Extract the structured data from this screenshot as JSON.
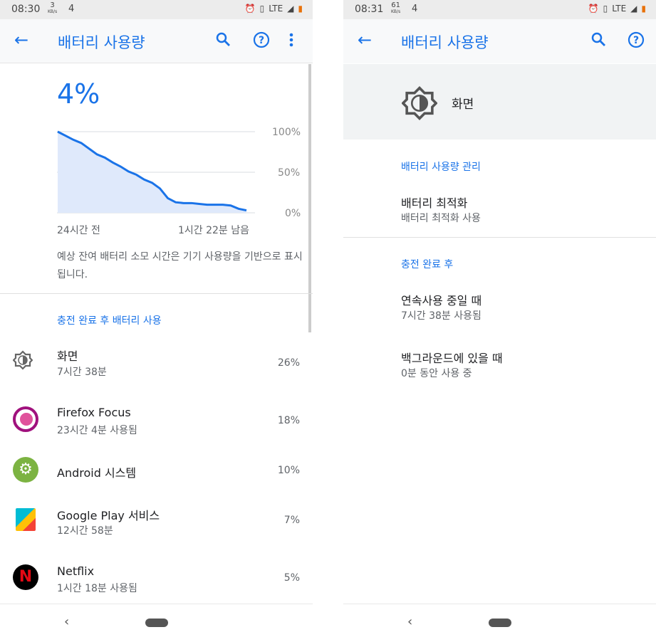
{
  "left": {
    "status": {
      "time": "08:30",
      "speed": "3",
      "speed_unit": "KB/s",
      "notif": "4",
      "network": "LTE"
    },
    "title": "배터리 사용량",
    "battery_percent": "4%",
    "chart_data": {
      "type": "area",
      "title": "",
      "y_ticks": [
        "100%",
        "50%",
        "0%"
      ],
      "x_labels": [
        "24시간 전",
        "1시간 22분 남음"
      ],
      "ylim": [
        0,
        100
      ],
      "x": [
        0,
        1,
        2,
        3,
        4,
        5,
        6,
        7,
        8,
        9,
        10,
        11,
        12,
        13,
        14,
        15,
        16,
        17,
        18,
        19,
        20,
        21,
        22,
        23,
        24
      ],
      "values": [
        100,
        95,
        90,
        86,
        79,
        72,
        68,
        62,
        57,
        51,
        47,
        41,
        37,
        30,
        18,
        13,
        12,
        12,
        11,
        10,
        10,
        10,
        9,
        5,
        3
      ]
    },
    "note": "예상 잔여 배터리 소모 시간은 기기 사용량을 기반으로 표시됩니다.",
    "section": "충전 완료 후 배터리 사용",
    "apps": [
      {
        "name": "화면",
        "sub": "7시간 38분",
        "pct": "26%",
        "icon": "brightness-icon"
      },
      {
        "name": "Firefox Focus",
        "sub": "23시간 4분 사용됨",
        "pct": "18%",
        "icon": "firefox-focus-icon"
      },
      {
        "name": "Android 시스템",
        "sub": "",
        "pct": "10%",
        "icon": "android-system-icon"
      },
      {
        "name": "Google Play 서비스",
        "sub": "12시간 58분",
        "pct": "7%",
        "icon": "google-play-services-icon"
      },
      {
        "name": "Netflix",
        "sub": "1시간 18분 사용됨",
        "pct": "5%",
        "icon": "netflix-icon"
      }
    ]
  },
  "right": {
    "status": {
      "time": "08:31",
      "speed": "61",
      "speed_unit": "KB/s",
      "notif": "4",
      "network": "LTE"
    },
    "title": "배터리 사용량",
    "header": "화면",
    "sec1": "배터리 사용량 관리",
    "opt_title": "배터리 최적화",
    "opt_sub": "배터리 최적화 사용",
    "sec2": "충전 완료 후",
    "fg_title": "연속사용 중일 때",
    "fg_sub": "7시간 38분 사용됨",
    "bg_title": "백그라운드에 있을 때",
    "bg_sub": "0분 동안 사용 중"
  },
  "colors": {
    "accent": "#1a73e8"
  }
}
